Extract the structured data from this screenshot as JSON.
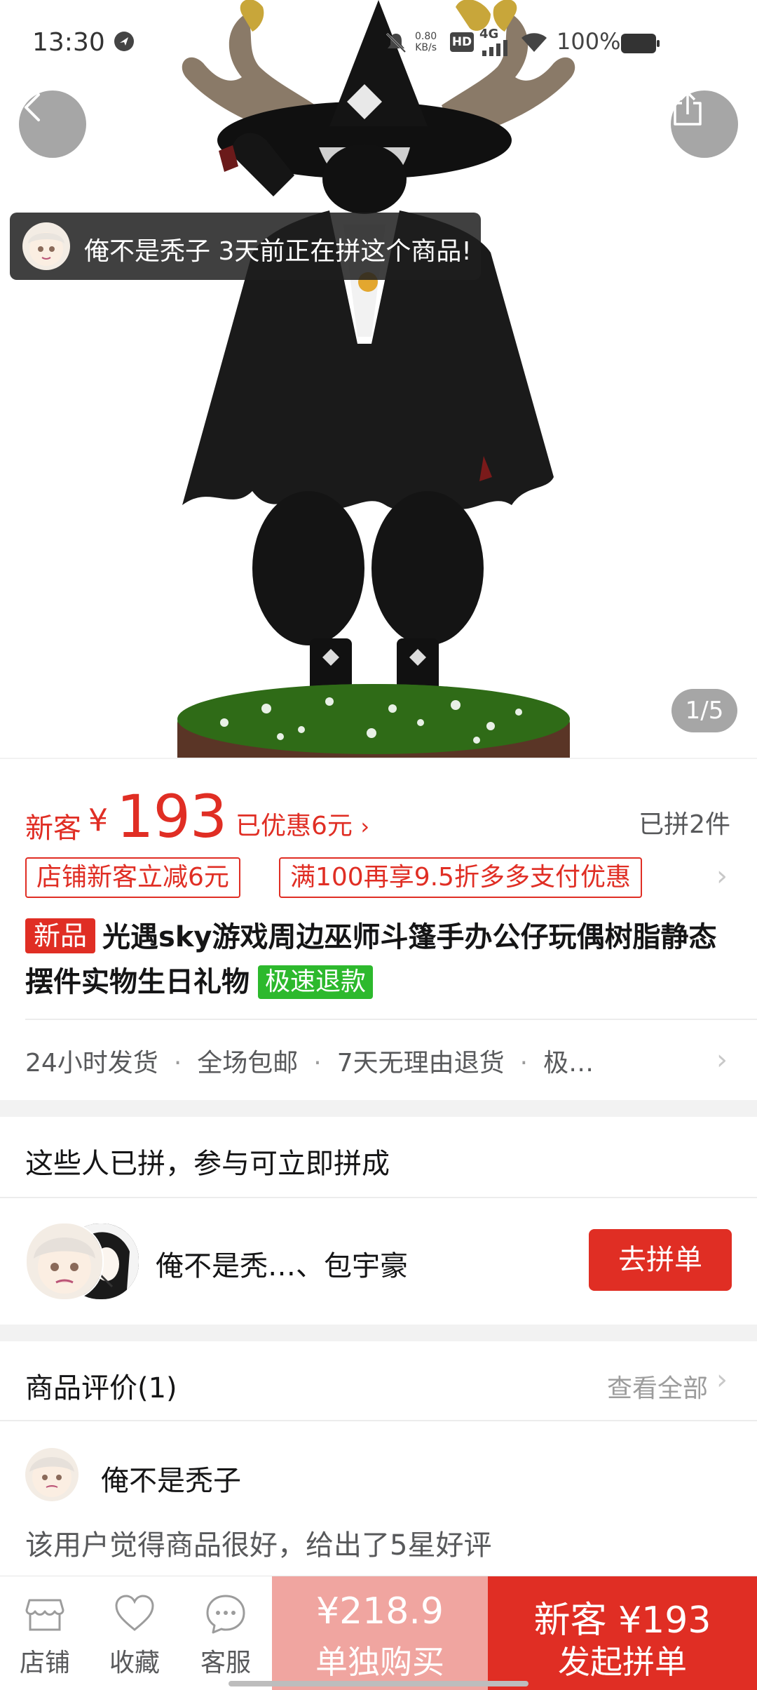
{
  "status_bar": {
    "time": "13:30",
    "net_speed_value": "0.80",
    "net_speed_unit": "KB/s",
    "hd": "HD",
    "network": "4G",
    "battery": "100%"
  },
  "gallery": {
    "pager": "1/5",
    "toast_text": "俺不是秃子 3天前正在拼这个商品!"
  },
  "price": {
    "new_customer": "新客",
    "currency": "¥",
    "amount": "193",
    "discount": "已优惠6元",
    "sold": "已拼2件"
  },
  "promo_tags": [
    "店铺新客立减6元",
    "满100再享9.5折多多支付优惠"
  ],
  "product": {
    "badge_new": "新品",
    "title": "光遇sky游戏周边巫师斗篷手办公仔玩偶树脂静态摆件实物生日礼物",
    "badge_refund": "极速退款"
  },
  "services": [
    "24小时发货",
    "全场包邮",
    "7天无理由退货",
    "极…"
  ],
  "group_buy": {
    "title": "这些人已拼，参与可立即拼成",
    "names": "俺不是秃…、包宇豪",
    "join_label": "去拼单"
  },
  "reviews": {
    "title": "商品评价(1)",
    "view_all": "查看全部",
    "reviewer": "俺不是秃子",
    "text": "该用户觉得商品很好，给出了5星好评"
  },
  "bottom_bar": {
    "store": "店铺",
    "favorite": "收藏",
    "service": "客服",
    "alone_price": "¥218.9",
    "alone_label": "单独购买",
    "group_price": "新客 ¥193",
    "group_label": "发起拼单"
  },
  "colors": {
    "accent": "#e02e24",
    "accent_light": "#f0a5a0",
    "refund_green": "#2db92d"
  }
}
